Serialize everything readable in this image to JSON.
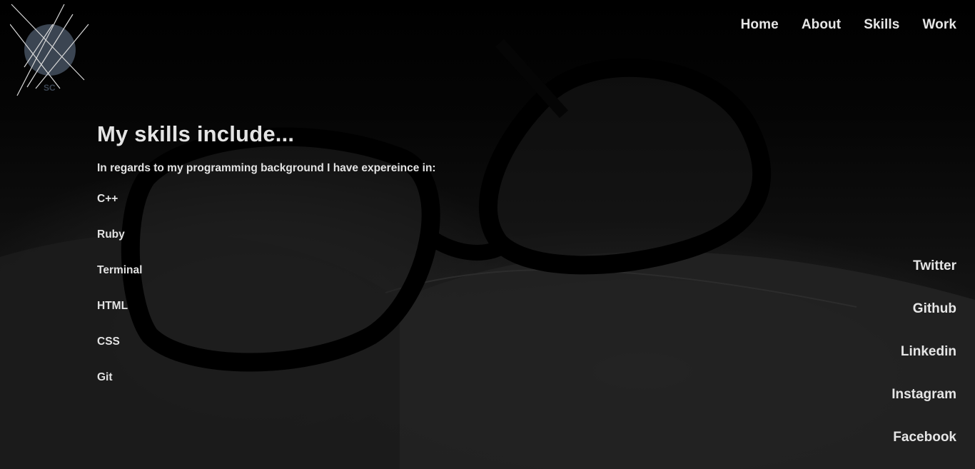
{
  "logo": {
    "initials": "SC"
  },
  "nav": {
    "items": [
      {
        "label": "Home"
      },
      {
        "label": "About"
      },
      {
        "label": "Skills"
      },
      {
        "label": "Work"
      }
    ]
  },
  "skills": {
    "title": "My skills include...",
    "intro": "In regards to my programming background I have expereince in:",
    "items": [
      "C++",
      "Ruby",
      "Terminal",
      "HTML",
      "CSS",
      "Git"
    ]
  },
  "social": {
    "items": [
      {
        "label": "Twitter"
      },
      {
        "label": "Github"
      },
      {
        "label": "Linkedin"
      },
      {
        "label": "Instagram"
      },
      {
        "label": "Facebook"
      }
    ]
  },
  "colors": {
    "text": "#e6e6e6",
    "background": "#0a0a0a",
    "logo_circle": "#3b4552"
  }
}
